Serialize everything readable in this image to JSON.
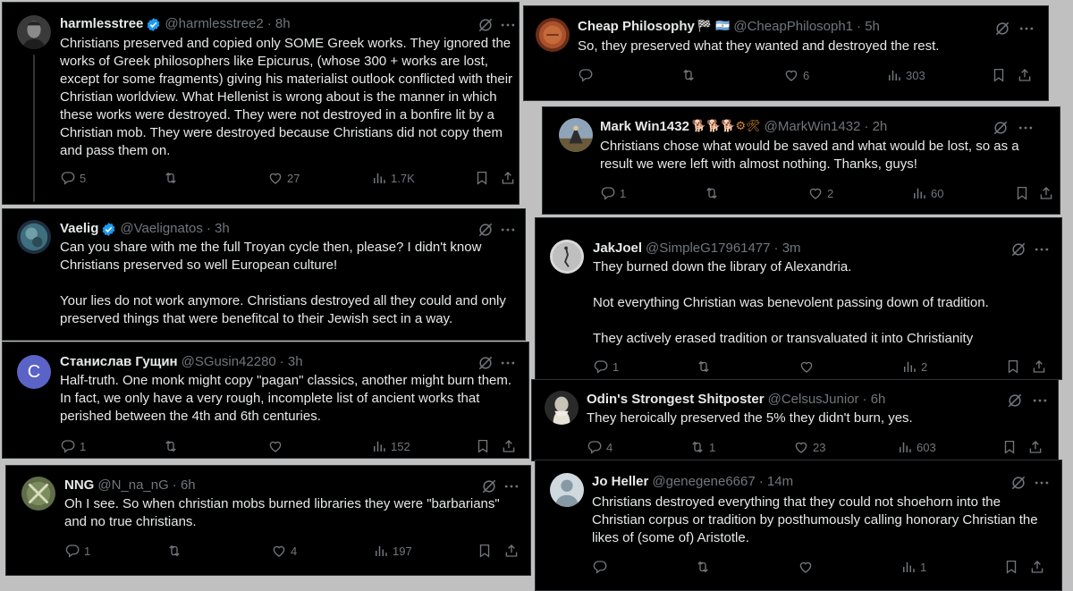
{
  "colors": {
    "background": "#000000",
    "text": "#e7e9ea",
    "muted": "#71767b",
    "verified": "#1d9bf0",
    "separator": "#c0c0c0"
  },
  "tweets": [
    {
      "name": "harmlesstree",
      "handle": "@harmlesstree2",
      "time": "· 8h",
      "text": "Christians preserved and copied only SOME Greek works. They ignored the works of Greek philosophers like Epicurus, (whose 300 + works are lost, except for some fragments) giving his materialist outlook conflicted with their Christian worldview. What Hellenist is wrong about is the manner in which these works were destroyed. They were not destroyed in a bonfire lit by a Christian mob. They were destroyed because Christians did not copy them and pass them on.",
      "replies": "5",
      "reposts": "",
      "likes": "27",
      "views": "1.7K"
    },
    {
      "name": "Vaelig",
      "handle": "@Vaelignatos",
      "time": "· 3h",
      "text": "Can you share with me the full Troyan cycle then, please? I didn't know Christians preserved so well European culture!\n\nYour lies do not work anymore. Christians destroyed all they could and only preserved things that were benefitcal to their Jewish sect in a way."
    },
    {
      "name": "Станислав Гущин",
      "handle": "@SGusin42280",
      "time": "· 3h",
      "avatar_letter": "C",
      "text": "Half-truth. One monk might copy \"pagan\" classics, another might burn them. In fact, we only have a very rough, incomplete list of ancient works that perished between the 4th and 6th centuries.",
      "replies": "1",
      "reposts": "",
      "likes": "",
      "views": "152"
    },
    {
      "name": "NNG",
      "handle": "@N_na_nG",
      "time": "· 6h",
      "text": "Oh I see. So when christian mobs burned libraries they were \"barbarians\" and no true christians.",
      "replies": "1",
      "reposts": "",
      "likes": "4",
      "views": "197"
    },
    {
      "name": "Cheap Philosophy",
      "emoji": "🏁 🇦🇷",
      "handle": "@CheapPhilosoph1",
      "time": "· 5h",
      "text": "So, they preserved what they wanted and destroyed the rest.",
      "replies": "",
      "reposts": "",
      "likes": "6",
      "views": "303"
    },
    {
      "name": "Mark Win1432",
      "emoji": "🐕🐕🐕⚙🛠",
      "handle": "@MarkWin1432",
      "time": "· 2h",
      "text": "Christians chose what would be saved and what would be lost, so as a result we were left with almost nothing. Thanks, guys!",
      "replies": "1",
      "reposts": "",
      "likes": "2",
      "views": "60"
    },
    {
      "name": "JakJoel",
      "handle": "@SimpleG17961477",
      "time": "· 3m",
      "text": "They burned down the library of Alexandria.\n\nNot everything Christian was benevolent passing down of tradition.\n\nThey actively erased tradition or transvaluated it into Christianity",
      "replies": "1",
      "reposts": "",
      "likes": "",
      "views": "2"
    },
    {
      "name": "Odin's Strongest Shitposter",
      "handle": "@CelsusJunior",
      "time": "· 6h",
      "text": "They heroically preserved the 5% they didn't burn, yes.",
      "replies": "4",
      "reposts": "1",
      "likes": "23",
      "views": "603"
    },
    {
      "name": "Jo Heller",
      "handle": "@genegene6667",
      "time": "· 14m",
      "text": "Christians destroyed everything that they could not shoehorn into the Christian corpus or tradition by posthumously calling honorary Christian the likes of (some of) Aristotle.",
      "replies": "",
      "reposts": "",
      "likes": "",
      "views": "1"
    }
  ]
}
